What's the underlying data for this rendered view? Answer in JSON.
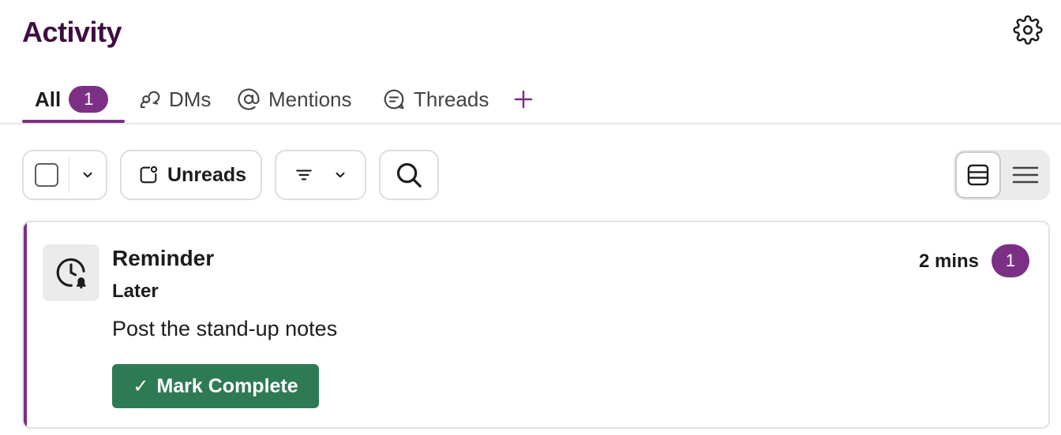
{
  "page": {
    "title": "Activity"
  },
  "tabs": [
    {
      "label": "All",
      "badge": "1",
      "icon": "",
      "active": true
    },
    {
      "label": "DMs",
      "icon": "dm-bubbles-icon"
    },
    {
      "label": "Mentions",
      "icon": "at-sign-icon"
    },
    {
      "label": "Threads",
      "icon": "thread-bubble-icon"
    },
    {
      "label": "",
      "icon": "plus-icon"
    }
  ],
  "toolbar": {
    "unreads_label": "Unreads",
    "icons": [
      "checkbox-icon",
      "chevron-down-icon",
      "unreads-icon",
      "filter-icon",
      "search-icon"
    ]
  },
  "view_toggle": {
    "options": [
      "card-view-icon",
      "list-view-icon"
    ],
    "selected": "card-view-icon"
  },
  "activity_item": {
    "icon": "clock-bell-icon",
    "title": "Reminder",
    "subtitle": "Later",
    "body": "Post the stand-up notes",
    "time": "2 mins",
    "badge": "1",
    "action_label": "Mark Complete"
  },
  "colors": {
    "title": "#3f0e40",
    "accent": "#7c3085",
    "action": "#2e7a55"
  }
}
